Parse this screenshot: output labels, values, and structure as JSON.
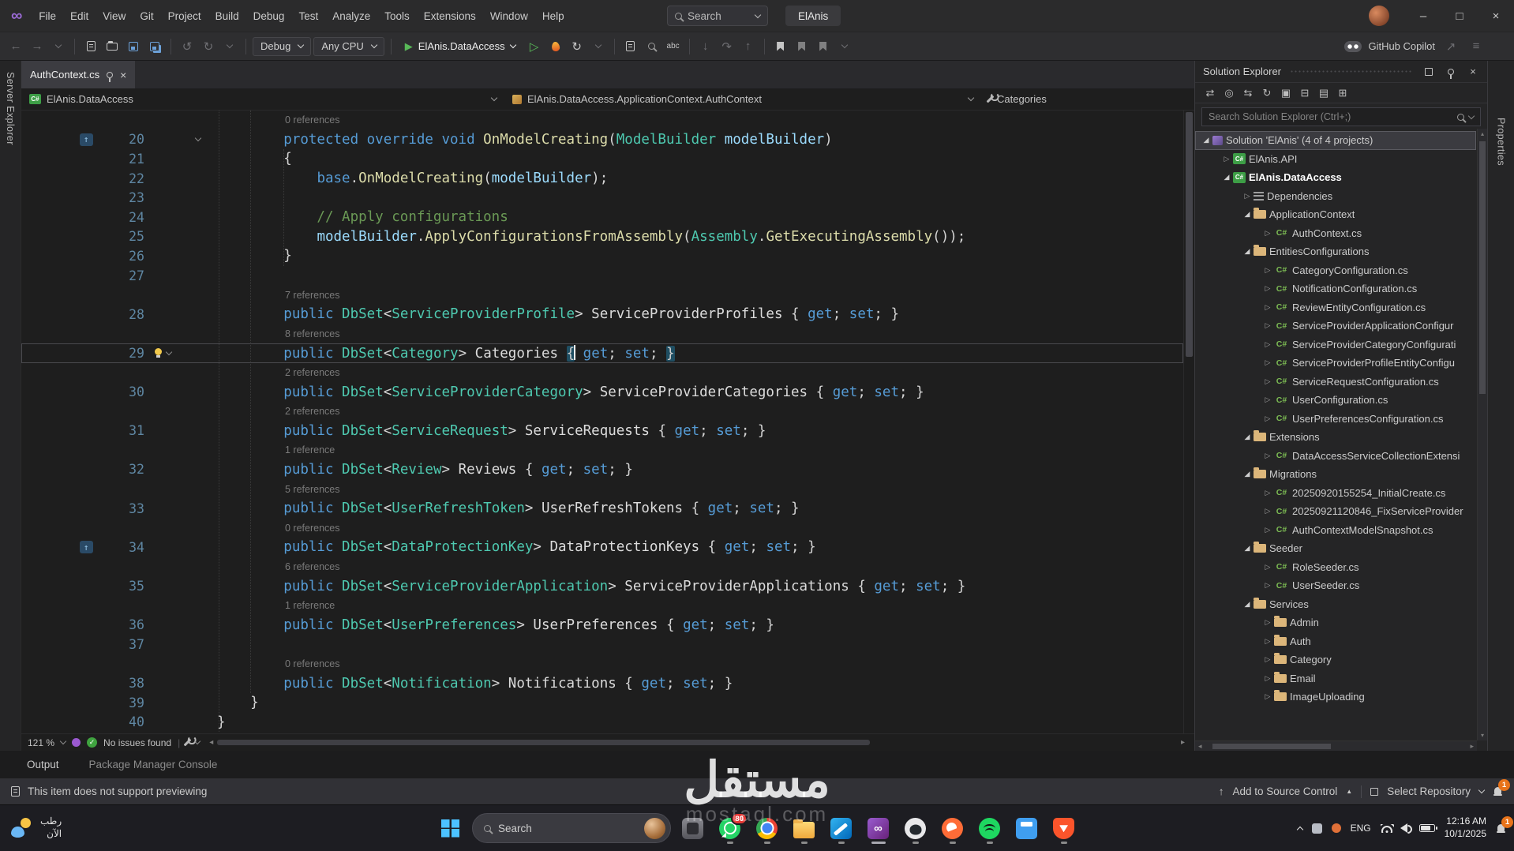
{
  "titlebar": {
    "logo": "∞",
    "menu": [
      "File",
      "Edit",
      "View",
      "Git",
      "Project",
      "Build",
      "Debug",
      "Test",
      "Analyze",
      "Tools",
      "Extensions",
      "Window",
      "Help"
    ],
    "search_label": "Search",
    "title": "ElAnis",
    "window_controls": {
      "minimize": "–",
      "maximize": "□",
      "close": "×"
    }
  },
  "toolbar": {
    "config": "Debug",
    "platform": "Any CPU",
    "run_target": "ElAnis.DataAccess",
    "spell_label": "abc",
    "copilot_label": "GitHub Copilot"
  },
  "left_strip": {
    "label": "Server Explorer"
  },
  "right_strip": {
    "label": "Properties"
  },
  "editor": {
    "tab": "AuthContext.cs",
    "breadcrumb": {
      "project": "ElAnis.DataAccess",
      "type": "ElAnis.DataAccess.ApplicationContext.AuthContext",
      "member": "Categories"
    },
    "status": {
      "zoom": "121 %",
      "issues": "No issues found"
    },
    "rows": [
      {
        "t": "ref",
        "s": "0 references"
      },
      {
        "t": "c",
        "n": 20,
        "g": true,
        "f": true,
        "k": [
          [
            "kw",
            "        protected override void "
          ],
          [
            "m",
            "OnModelCreating"
          ],
          [
            "p",
            "("
          ],
          [
            "ty",
            "ModelBuilder"
          ],
          [
            "p",
            " "
          ],
          [
            "pa",
            "modelBuilder"
          ],
          [
            "p",
            ")"
          ]
        ]
      },
      {
        "t": "c",
        "n": 21,
        "k": [
          [
            "p",
            "        {"
          ]
        ]
      },
      {
        "t": "c",
        "n": 22,
        "k": [
          [
            "p",
            "            "
          ],
          [
            "kw",
            "base"
          ],
          [
            "p",
            "."
          ],
          [
            "m",
            "OnModelCreating"
          ],
          [
            "p",
            "("
          ],
          [
            "pa",
            "modelBuilder"
          ],
          [
            "p",
            ");"
          ]
        ]
      },
      {
        "t": "c",
        "n": 23,
        "k": []
      },
      {
        "t": "c",
        "n": 24,
        "k": [
          [
            "cm",
            "            // Apply configurations"
          ]
        ]
      },
      {
        "t": "c",
        "n": 25,
        "k": [
          [
            "p",
            "            "
          ],
          [
            "pa",
            "modelBuilder"
          ],
          [
            "p",
            "."
          ],
          [
            "m",
            "ApplyConfigurationsFromAssembly"
          ],
          [
            "p",
            "("
          ],
          [
            "ty",
            "Assembly"
          ],
          [
            "p",
            "."
          ],
          [
            "m",
            "GetExecutingAssembly"
          ],
          [
            "p",
            "());"
          ]
        ]
      },
      {
        "t": "c",
        "n": 26,
        "k": [
          [
            "p",
            "        }"
          ]
        ]
      },
      {
        "t": "c",
        "n": 27,
        "k": []
      },
      {
        "t": "ref",
        "s": "7 references"
      },
      {
        "t": "c",
        "n": 28,
        "k": [
          [
            "kw",
            "        public "
          ],
          [
            "ty",
            "DbSet"
          ],
          [
            "p",
            "<"
          ],
          [
            "ty",
            "ServiceProviderProfile"
          ],
          [
            "p",
            "> "
          ],
          [
            "id",
            "ServiceProviderProfiles"
          ],
          [
            "p",
            " { "
          ],
          [
            "kw",
            "get"
          ],
          [
            "p",
            "; "
          ],
          [
            "kw",
            "set"
          ],
          [
            "p",
            "; }"
          ]
        ]
      },
      {
        "t": "ref",
        "s": "8 references"
      },
      {
        "t": "c",
        "n": 29,
        "cur": true,
        "b": true,
        "k": [
          [
            "kw",
            "        public "
          ],
          [
            "ty",
            "DbSet"
          ],
          [
            "p",
            "<"
          ],
          [
            "ty",
            "Category"
          ],
          [
            "p",
            "> "
          ],
          [
            "id",
            "Categories"
          ],
          [
            "p",
            " "
          ],
          [
            "bh",
            "{"
          ],
          [
            "caret",
            ""
          ],
          [
            "p",
            " "
          ],
          [
            "kw",
            "get"
          ],
          [
            "p",
            "; "
          ],
          [
            "kw",
            "set"
          ],
          [
            "p",
            "; "
          ],
          [
            "bh",
            "}"
          ]
        ]
      },
      {
        "t": "ref",
        "s": "2 references"
      },
      {
        "t": "c",
        "n": 30,
        "k": [
          [
            "kw",
            "        public "
          ],
          [
            "ty",
            "DbSet"
          ],
          [
            "p",
            "<"
          ],
          [
            "ty",
            "ServiceProviderCategory"
          ],
          [
            "p",
            "> "
          ],
          [
            "id",
            "ServiceProviderCategories"
          ],
          [
            "p",
            " { "
          ],
          [
            "kw",
            "get"
          ],
          [
            "p",
            "; "
          ],
          [
            "kw",
            "set"
          ],
          [
            "p",
            "; }"
          ]
        ]
      },
      {
        "t": "ref",
        "s": "2 references"
      },
      {
        "t": "c",
        "n": 31,
        "k": [
          [
            "kw",
            "        public "
          ],
          [
            "ty",
            "DbSet"
          ],
          [
            "p",
            "<"
          ],
          [
            "ty",
            "ServiceRequest"
          ],
          [
            "p",
            "> "
          ],
          [
            "id",
            "ServiceRequests"
          ],
          [
            "p",
            " { "
          ],
          [
            "kw",
            "get"
          ],
          [
            "p",
            "; "
          ],
          [
            "kw",
            "set"
          ],
          [
            "p",
            "; }"
          ]
        ]
      },
      {
        "t": "ref",
        "s": "1 reference"
      },
      {
        "t": "c",
        "n": 32,
        "k": [
          [
            "kw",
            "        public "
          ],
          [
            "ty",
            "DbSet"
          ],
          [
            "p",
            "<"
          ],
          [
            "ty",
            "Review"
          ],
          [
            "p",
            "> "
          ],
          [
            "id",
            "Reviews"
          ],
          [
            "p",
            " { "
          ],
          [
            "kw",
            "get"
          ],
          [
            "p",
            "; "
          ],
          [
            "kw",
            "set"
          ],
          [
            "p",
            "; }"
          ]
        ]
      },
      {
        "t": "ref",
        "s": "5 references"
      },
      {
        "t": "c",
        "n": 33,
        "k": [
          [
            "kw",
            "        public "
          ],
          [
            "ty",
            "DbSet"
          ],
          [
            "p",
            "<"
          ],
          [
            "ty",
            "UserRefreshToken"
          ],
          [
            "p",
            "> "
          ],
          [
            "id",
            "UserRefreshTokens"
          ],
          [
            "p",
            " { "
          ],
          [
            "kw",
            "get"
          ],
          [
            "p",
            "; "
          ],
          [
            "kw",
            "set"
          ],
          [
            "p",
            "; }"
          ]
        ]
      },
      {
        "t": "ref",
        "s": "0 references"
      },
      {
        "t": "c",
        "n": 34,
        "g": true,
        "k": [
          [
            "kw",
            "        public "
          ],
          [
            "ty",
            "DbSet"
          ],
          [
            "p",
            "<"
          ],
          [
            "ty",
            "DataProtectionKey"
          ],
          [
            "p",
            "> "
          ],
          [
            "id",
            "DataProtectionKeys"
          ],
          [
            "p",
            " { "
          ],
          [
            "kw",
            "get"
          ],
          [
            "p",
            "; "
          ],
          [
            "kw",
            "set"
          ],
          [
            "p",
            "; }"
          ]
        ]
      },
      {
        "t": "ref",
        "s": "6 references"
      },
      {
        "t": "c",
        "n": 35,
        "k": [
          [
            "kw",
            "        public "
          ],
          [
            "ty",
            "DbSet"
          ],
          [
            "p",
            "<"
          ],
          [
            "ty",
            "ServiceProviderApplication"
          ],
          [
            "p",
            "> "
          ],
          [
            "id",
            "ServiceProviderApplications"
          ],
          [
            "p",
            " { "
          ],
          [
            "kw",
            "get"
          ],
          [
            "p",
            "; "
          ],
          [
            "kw",
            "set"
          ],
          [
            "p",
            "; }"
          ]
        ]
      },
      {
        "t": "ref",
        "s": "1 reference"
      },
      {
        "t": "c",
        "n": 36,
        "k": [
          [
            "kw",
            "        public "
          ],
          [
            "ty",
            "DbSet"
          ],
          [
            "p",
            "<"
          ],
          [
            "ty",
            "UserPreferences"
          ],
          [
            "p",
            "> "
          ],
          [
            "id",
            "UserPreferences"
          ],
          [
            "p",
            " { "
          ],
          [
            "kw",
            "get"
          ],
          [
            "p",
            "; "
          ],
          [
            "kw",
            "set"
          ],
          [
            "p",
            "; }"
          ]
        ]
      },
      {
        "t": "c",
        "n": 37,
        "k": []
      },
      {
        "t": "ref",
        "s": "0 references"
      },
      {
        "t": "c",
        "n": 38,
        "k": [
          [
            "kw",
            "        public "
          ],
          [
            "ty",
            "DbSet"
          ],
          [
            "p",
            "<"
          ],
          [
            "ty",
            "Notification"
          ],
          [
            "p",
            "> "
          ],
          [
            "id",
            "Notifications"
          ],
          [
            "p",
            " { "
          ],
          [
            "kw",
            "get"
          ],
          [
            "p",
            "; "
          ],
          [
            "kw",
            "set"
          ],
          [
            "p",
            "; }"
          ]
        ]
      },
      {
        "t": "c",
        "n": 39,
        "k": [
          [
            "p",
            "    }"
          ]
        ]
      },
      {
        "t": "c",
        "n": 40,
        "k": [
          [
            "p",
            "}"
          ]
        ]
      }
    ]
  },
  "bottom_panel": {
    "tabs": [
      "Output",
      "Package Manager Console"
    ]
  },
  "preview_bar": {
    "message": "This item does not support previewing",
    "add_source": "Add to Source Control",
    "select_repo": "Select Repository",
    "notification_count": "1"
  },
  "solution_explorer": {
    "title": "Solution Explorer",
    "search_placeholder": "Search Solution Explorer (Ctrl+;)",
    "toolbar_icons": [
      {
        "name": "switch-views-icon",
        "glyph": "⇄"
      },
      {
        "name": "pending-changes-filter-icon",
        "glyph": "◎"
      },
      {
        "name": "sync-with-active-document-icon",
        "glyph": "⇆"
      },
      {
        "name": "refresh-icon",
        "glyph": "↻"
      },
      {
        "name": "nest-files-icon",
        "glyph": "▣"
      },
      {
        "name": "collapse-all-icon",
        "glyph": "⊟"
      },
      {
        "name": "show-all-files-icon",
        "glyph": "▤"
      },
      {
        "name": "properties-icon",
        "glyph": "⊞"
      }
    ],
    "tree": [
      {
        "d": 0,
        "e": "open",
        "icon": "solution",
        "label": "Solution 'ElAnis' (4 of 4 projects)",
        "sel": true
      },
      {
        "d": 1,
        "e": "closed",
        "icon": "csproj",
        "label": "ElAnis.API"
      },
      {
        "d": 1,
        "e": "open",
        "icon": "csproj",
        "label": "ElAnis.DataAccess",
        "bold": true
      },
      {
        "d": 2,
        "e": "closed",
        "icon": "deps",
        "label": "Dependencies"
      },
      {
        "d": 2,
        "e": "open",
        "icon": "folder",
        "label": "ApplicationContext"
      },
      {
        "d": 3,
        "e": "closed",
        "icon": "cs",
        "label": "AuthContext.cs"
      },
      {
        "d": 2,
        "e": "open",
        "icon": "folder",
        "label": "EntitiesConfigurations"
      },
      {
        "d": 3,
        "e": "closed",
        "icon": "cs",
        "label": "CategoryConfiguration.cs"
      },
      {
        "d": 3,
        "e": "closed",
        "icon": "cs",
        "label": "NotificationConfiguration.cs"
      },
      {
        "d": 3,
        "e": "closed",
        "icon": "cs",
        "label": "ReviewEntityConfiguration.cs"
      },
      {
        "d": 3,
        "e": "closed",
        "icon": "cs",
        "label": "ServiceProviderApplicationConfigur"
      },
      {
        "d": 3,
        "e": "closed",
        "icon": "cs",
        "label": "ServiceProviderCategoryConfigurati"
      },
      {
        "d": 3,
        "e": "closed",
        "icon": "cs",
        "label": "ServiceProviderProfileEntityConfigu"
      },
      {
        "d": 3,
        "e": "closed",
        "icon": "cs",
        "label": "ServiceRequestConfiguration.cs"
      },
      {
        "d": 3,
        "e": "closed",
        "icon": "cs",
        "label": "UserConfiguration.cs"
      },
      {
        "d": 3,
        "e": "closed",
        "icon": "cs",
        "label": "UserPreferencesConfiguration.cs"
      },
      {
        "d": 2,
        "e": "open",
        "icon": "folder",
        "label": "Extensions"
      },
      {
        "d": 3,
        "e": "closed",
        "icon": "cs",
        "label": "DataAccessServiceCollectionExtensi"
      },
      {
        "d": 2,
        "e": "open",
        "icon": "folder",
        "label": "Migrations"
      },
      {
        "d": 3,
        "e": "closed",
        "icon": "cs",
        "label": "20250920155254_InitialCreate.cs"
      },
      {
        "d": 3,
        "e": "closed",
        "icon": "cs",
        "label": "20250921120846_FixServiceProvider"
      },
      {
        "d": 3,
        "e": "closed",
        "icon": "cs",
        "label": "AuthContextModelSnapshot.cs"
      },
      {
        "d": 2,
        "e": "open",
        "icon": "folder",
        "label": "Seeder"
      },
      {
        "d": 3,
        "e": "closed",
        "icon": "cs",
        "label": "RoleSeeder.cs"
      },
      {
        "d": 3,
        "e": "closed",
        "icon": "cs",
        "label": "UserSeeder.cs"
      },
      {
        "d": 2,
        "e": "open",
        "icon": "folder",
        "label": "Services"
      },
      {
        "d": 3,
        "e": "closed",
        "icon": "folder",
        "label": "Admin"
      },
      {
        "d": 3,
        "e": "closed",
        "icon": "folder",
        "label": "Auth"
      },
      {
        "d": 3,
        "e": "closed",
        "icon": "folder",
        "label": "Category"
      },
      {
        "d": 3,
        "e": "closed",
        "icon": "folder",
        "label": "Email"
      },
      {
        "d": 3,
        "e": "closed",
        "icon": "folder",
        "label": "ImageUploading"
      }
    ]
  },
  "taskbar": {
    "weather": {
      "line1": "رطب",
      "line2": "الآن"
    },
    "search_label": "Search",
    "apps": [
      {
        "name": "system-app",
        "kind": "graybox",
        "running": false
      },
      {
        "name": "whatsapp",
        "kind": "whatsapp",
        "badge": "80",
        "running": true
      },
      {
        "name": "chrome",
        "kind": "chrome",
        "running": true
      },
      {
        "name": "file-explorer",
        "kind": "folder",
        "running": true
      },
      {
        "name": "vscode",
        "kind": "vscode",
        "running": true
      },
      {
        "name": "visual-studio",
        "kind": "visualstudio",
        "glyph": "∞",
        "running": true,
        "active": true
      },
      {
        "name": "github-desktop",
        "kind": "github",
        "running": true
      },
      {
        "name": "postman",
        "kind": "postman",
        "running": true
      },
      {
        "name": "spotify",
        "kind": "spotify",
        "running": true
      },
      {
        "name": "calculator",
        "kind": "calculator",
        "running": false
      },
      {
        "name": "brave",
        "kind": "brave",
        "running": true
      }
    ],
    "tray": {
      "lang": "ENG",
      "time": "12:16 AM",
      "date": "10/1/2025",
      "notification_count": "1"
    }
  },
  "watermark": {
    "arabic": "مستقل",
    "latin": "mostaql.com"
  }
}
